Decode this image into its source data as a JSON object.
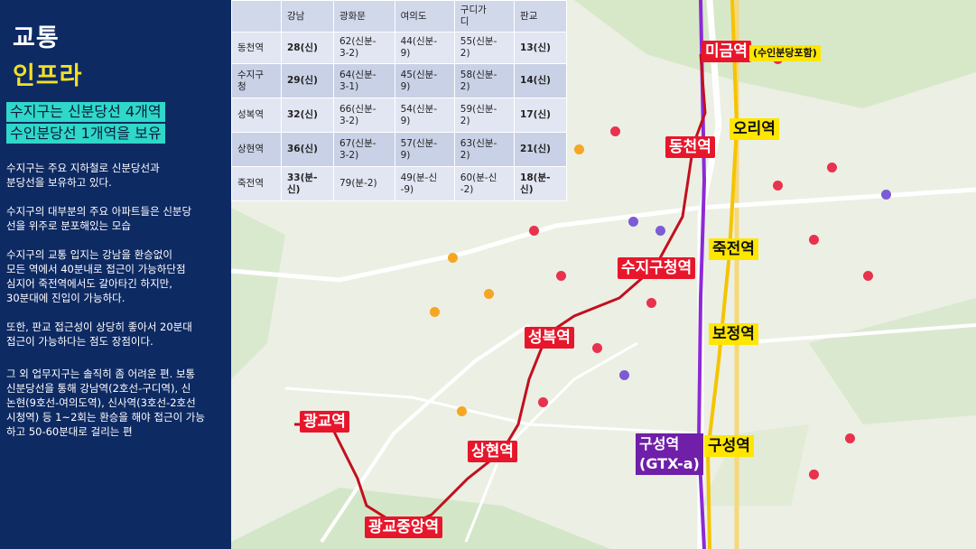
{
  "sidebar": {
    "title_line1": "교통",
    "title_line2": "인프라",
    "highlight_line1": "수지구는 신분당선 4개역",
    "highlight_line2": "수인분당선 1개역을 보유",
    "paragraphs": [
      "수지구는 주요 지하철로 신분당선과\n분당선을 보유하고 있다.",
      "수지구의 대부분의 주요 아파트들은 신분당\n선을 위주로 분포해있는 모습",
      "수지구의 교통 입지는 강남을 환승없이\n모든 역에서 40분내로 접근이 가능하단점\n심지어 죽전역에서도 갈아타긴 하지만,\n30분대에 진입이 가능하다.",
      "또한, 판교 접근성이 상당히 좋아서 20분대\n접근이 가능하다는 점도 장점이다.",
      "그 외 업무지구는 솔직히 좀 어려운 편. 보통\n신분당선을 통해 강남역(2호선-구디역), 신\n논현(9호선-여의도역), 신사역(3호선-2호선\n시청역) 등 1~2회는 환승을 해야 접근이 가능\n하고 50-60분대로 걸리는 편"
    ]
  },
  "table": {
    "headers": [
      "",
      "강남",
      "광화문",
      "여의도",
      "구디가\n디",
      "판교"
    ],
    "rows": [
      [
        "동천역",
        "28(신)",
        "62(신분-\n3-2)",
        "44(신분-\n9)",
        "55(신분-\n2)",
        "13(신)"
      ],
      [
        "수지구\n청",
        "29(신)",
        "64(신분-\n3-1)",
        "45(신분-\n9)",
        "58(신분-\n2)",
        "14(신)"
      ],
      [
        "성복역",
        "32(신)",
        "66(신분-\n3-2)",
        "54(신분-\n9)",
        "59(신분-\n2)",
        "17(신)"
      ],
      [
        "상현역",
        "36(신)",
        "67(신분-\n3-2)",
        "57(신분-\n9)",
        "63(신분-\n2)",
        "21(신)"
      ],
      [
        "죽전역",
        "33(분-\n신)",
        "79(분-2)",
        "49(분-신\n-9)",
        "60(분-신\n-2)",
        "18(분-\n신)"
      ]
    ]
  },
  "map": {
    "stations": {
      "migeum": "미금역",
      "migeum_note": "(수인분당포함)",
      "ori": "오리역",
      "dongcheon": "동천역",
      "jukjeon": "죽전역",
      "sujigucheong": "수지구청역",
      "bojeong": "보정역",
      "seongbok": "성복역",
      "gwanggyo": "광교역",
      "sanghyeon": "상현역",
      "guseong_gtx": "구성역\n(GTX-a)",
      "guseong": "구성역",
      "gwanggyo_jungang": "광교중앙역"
    },
    "colors": {
      "shinbundang": "#d4101e",
      "suin_bundang": "#f5c400",
      "gtx": "#8b2bd6"
    }
  }
}
